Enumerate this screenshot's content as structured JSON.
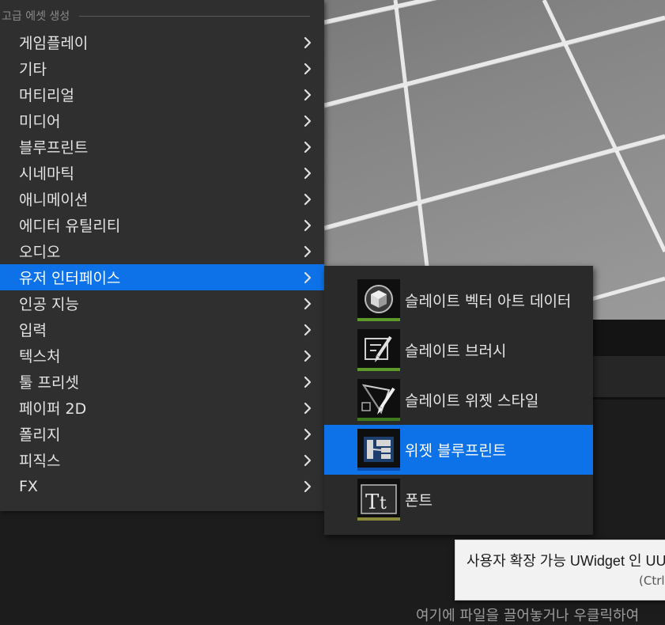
{
  "menu": {
    "section_header": "고급 에셋 생성",
    "items": [
      {
        "label": "게임플레이"
      },
      {
        "label": "기타"
      },
      {
        "label": "머티리얼"
      },
      {
        "label": "미디어"
      },
      {
        "label": "블루프린트"
      },
      {
        "label": "시네마틱"
      },
      {
        "label": "애니메이션"
      },
      {
        "label": "에디터 유틸리티"
      },
      {
        "label": "오디오"
      },
      {
        "label": "유저 인터페이스",
        "active": true
      },
      {
        "label": "인공 지능"
      },
      {
        "label": "입력"
      },
      {
        "label": "텍스처"
      },
      {
        "label": "툴 프리셋"
      },
      {
        "label": "페이퍼 2D"
      },
      {
        "label": "폴리지"
      },
      {
        "label": "피직스"
      },
      {
        "label": "FX"
      }
    ]
  },
  "submenu": {
    "items": [
      {
        "label": "슬레이트 벡터 아트 데이터",
        "icon": "cube-icon",
        "bar_color": "#5e9a2a"
      },
      {
        "label": "슬레이트 브러시",
        "icon": "brush-icon",
        "bar_color": "#5e9a2a"
      },
      {
        "label": "슬레이트 위젯 스타일",
        "icon": "widget-style-icon",
        "bar_color": "#3f7a1e"
      },
      {
        "label": "위젯 블루프린트",
        "icon": "widget-blueprint-icon",
        "bar_color": "#0a4fb0",
        "active": true
      },
      {
        "label": "폰트",
        "icon": "font-icon",
        "bar_color": "#8a8a3a"
      }
    ]
  },
  "tooltip": {
    "text": "사용자 확장 가능 UWidget 인 UUs",
    "shortcut": "(Ctrl"
  },
  "content_browser": {
    "drop_hint": "여기에 파일을 끌어놓거나 우클릭하여"
  },
  "colors": {
    "accent": "#0d72e8",
    "menu_bg": "#2f2f2f",
    "submenu_bg": "#2a2a2a"
  }
}
